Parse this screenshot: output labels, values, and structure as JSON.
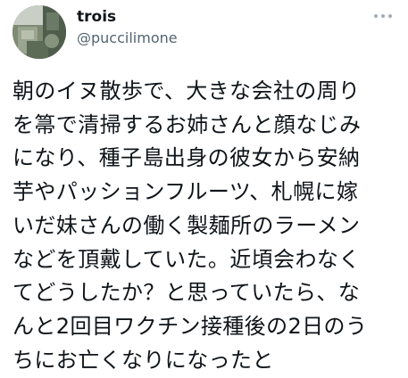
{
  "tweet": {
    "author": {
      "display_name": "trois",
      "handle": "@puccilimone",
      "avatar_icon": "profile-photo-avatar"
    },
    "more_icon": "more-options-icon",
    "lines": [
      "朝のイヌ散歩で、大きな会社の周り",
      "を箒で清掃するお姉さんと顔なじみ",
      "になり、種子島出身の彼女から安納",
      "芋やパッションフルーツ、札幌に嫁",
      "いだ妹さんの働く製麺所のラーメン",
      "などを頂戴していた。近頃会わなく",
      "てどうしたか？と思っていたら、な",
      "んと2回目ワクチン接種後の2日のう",
      "ちにお亡くなりになったと"
    ]
  },
  "colors": {
    "text": "#0f1419",
    "secondary": "#536471",
    "background": "#ffffff",
    "more_dots": "#a3adb6"
  }
}
